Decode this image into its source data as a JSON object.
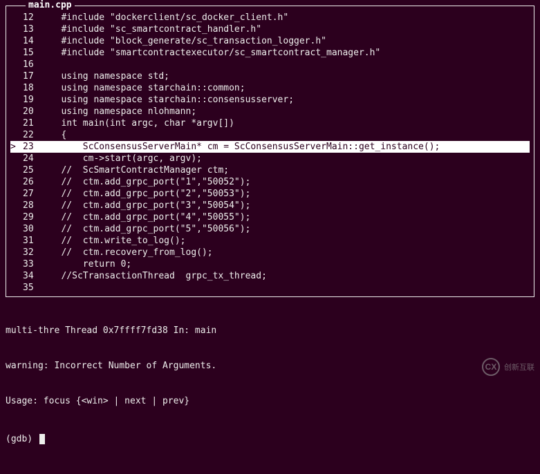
{
  "filename": "main.cpp",
  "breakpoint_marker": ">",
  "code_lines": [
    {
      "num": "12",
      "gutter": "",
      "text": "   #include \"dockerclient/sc_docker_client.h\"",
      "highlighted": false
    },
    {
      "num": "13",
      "gutter": "",
      "text": "   #include \"sc_smartcontract_handler.h\"",
      "highlighted": false
    },
    {
      "num": "14",
      "gutter": "",
      "text": "   #include \"block_generate/sc_transaction_logger.h\"",
      "highlighted": false
    },
    {
      "num": "15",
      "gutter": "",
      "text": "   #include \"smartcontractexecutor/sc_smartcontract_manager.h\"",
      "highlighted": false
    },
    {
      "num": "16",
      "gutter": "",
      "text": "",
      "highlighted": false
    },
    {
      "num": "17",
      "gutter": "",
      "text": "   using namespace std;",
      "highlighted": false
    },
    {
      "num": "18",
      "gutter": "",
      "text": "   using namespace starchain::common;",
      "highlighted": false
    },
    {
      "num": "19",
      "gutter": "",
      "text": "   using namespace starchain::consensusserver;",
      "highlighted": false
    },
    {
      "num": "20",
      "gutter": "",
      "text": "   using namespace nlohmann;",
      "highlighted": false
    },
    {
      "num": "21",
      "gutter": "",
      "text": "   int main(int argc, char *argv[])",
      "highlighted": false
    },
    {
      "num": "22",
      "gutter": "",
      "text": "   {",
      "highlighted": false
    },
    {
      "num": "23",
      "gutter": "> ",
      "text": "       ScConsensusServerMain* cm = ScConsensusServerMain::get_instance();",
      "highlighted": true
    },
    {
      "num": "24",
      "gutter": "",
      "text": "       cm->start(argc, argv);",
      "highlighted": false
    },
    {
      "num": "25",
      "gutter": "",
      "text": "   //  ScSmartContractManager ctm;",
      "highlighted": false
    },
    {
      "num": "26",
      "gutter": "",
      "text": "   //  ctm.add_grpc_port(\"1\",\"50052\");",
      "highlighted": false
    },
    {
      "num": "27",
      "gutter": "",
      "text": "   //  ctm.add_grpc_port(\"2\",\"50053\");",
      "highlighted": false
    },
    {
      "num": "28",
      "gutter": "",
      "text": "   //  ctm.add_grpc_port(\"3\",\"50054\");",
      "highlighted": false
    },
    {
      "num": "29",
      "gutter": "",
      "text": "   //  ctm.add_grpc_port(\"4\",\"50055\");",
      "highlighted": false
    },
    {
      "num": "30",
      "gutter": "",
      "text": "   //  ctm.add_grpc_port(\"5\",\"50056\");",
      "highlighted": false
    },
    {
      "num": "31",
      "gutter": "",
      "text": "   //  ctm.write_to_log();",
      "highlighted": false
    },
    {
      "num": "32",
      "gutter": "",
      "text": "   //  ctm.recovery_from_log();",
      "highlighted": false
    },
    {
      "num": "33",
      "gutter": "",
      "text": "       return 0;",
      "highlighted": false
    },
    {
      "num": "34",
      "gutter": "",
      "text": "   //ScTransactionThread  grpc_tx_thread;",
      "highlighted": false
    },
    {
      "num": "35",
      "gutter": "",
      "text": "",
      "highlighted": false
    }
  ],
  "status_line": "multi-thre Thread 0x7ffff7fd38 In: main",
  "warning_line": "warning: Incorrect Number of Arguments.",
  "usage_line": "Usage: focus {<win> | next | prev}",
  "prompt": "(gdb) ",
  "watermark": "创新互联"
}
